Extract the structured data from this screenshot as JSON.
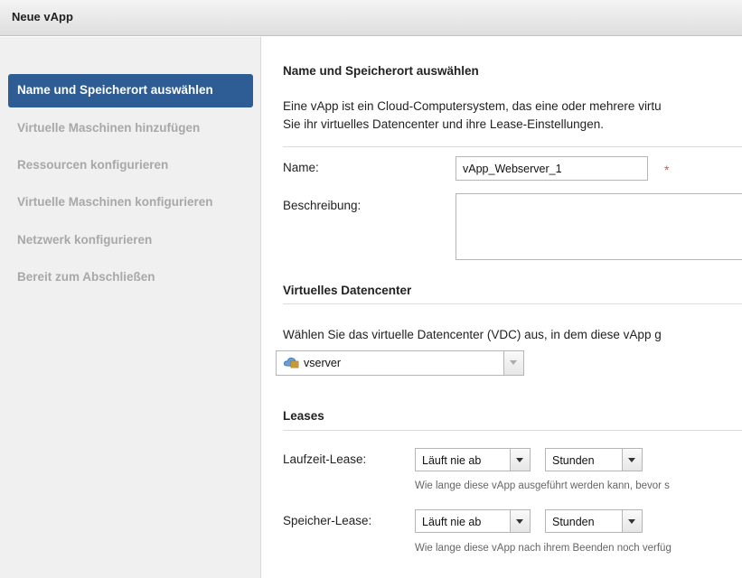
{
  "window": {
    "title": "Neue vApp"
  },
  "sidebar": {
    "items": [
      {
        "label": "Name und Speicherort auswählen",
        "active": true
      },
      {
        "label": "Virtuelle Maschinen hinzufügen",
        "active": false
      },
      {
        "label": "Ressourcen konfigurieren",
        "active": false
      },
      {
        "label": "Virtuelle Maschinen konfigurieren",
        "active": false
      },
      {
        "label": "Netzwerk konfigurieren",
        "active": false
      },
      {
        "label": "Bereit zum Abschließen",
        "active": false
      }
    ],
    "active_color": "#2e5d96"
  },
  "main": {
    "heading": "Name und Speicherort auswählen",
    "intro_line1": "Eine vApp ist ein Cloud-Computersystem, das eine oder mehrere virtu",
    "intro_line2": "Sie ihr virtuelles Datencenter und ihre Lease-Einstellungen.",
    "name_label": "Name:",
    "name_value": "vApp_Webserver_1",
    "required_marker": "*",
    "description_label": "Beschreibung:",
    "description_value": "",
    "vdc_heading": "Virtuelles Datencenter",
    "vdc_text": "Wählen Sie das virtuelle Datencenter (VDC) aus, in dem diese vApp g",
    "vdc_selected": "vserver",
    "vdc_icon": "cloud-datacenter-icon",
    "leases_heading": "Leases",
    "runtime_lease_label": "Laufzeit-Lease:",
    "runtime_lease_value": "Läuft nie ab",
    "runtime_lease_unit": "Stunden",
    "runtime_lease_hint": "Wie lange diese vApp ausgeführt werden kann, bevor s",
    "storage_lease_label": "Speicher-Lease:",
    "storage_lease_value": "Läuft nie ab",
    "storage_lease_unit": "Stunden",
    "storage_lease_hint": "Wie lange diese vApp nach ihrem Beenden noch verfüg"
  }
}
